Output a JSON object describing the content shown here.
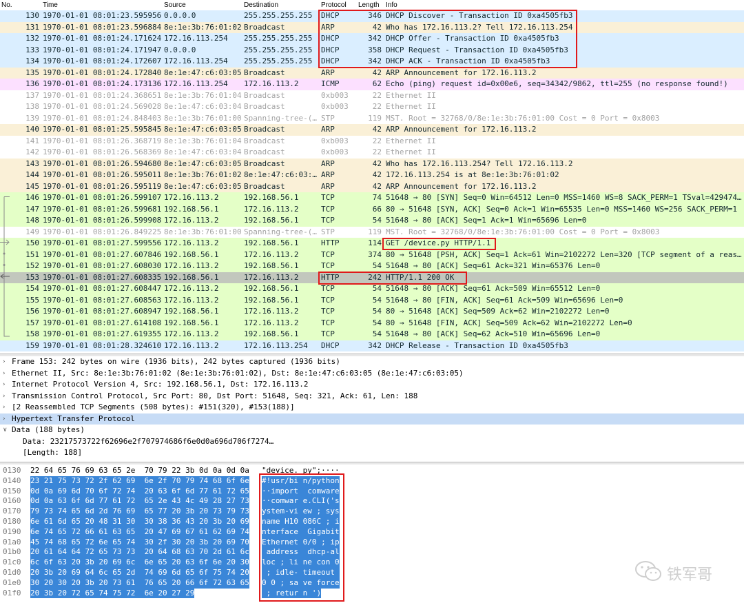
{
  "columns": {
    "no": "No.",
    "time": "Time",
    "source": "Source",
    "destination": "Destination",
    "protocol": "Protocol",
    "length": "Length",
    "info": "Info"
  },
  "packets": [
    {
      "no": "130",
      "time": "1970-01-01 08:01:23.595956",
      "src": "0.0.0.0",
      "dst": "255.255.255.255",
      "proto": "DHCP",
      "len": "346",
      "info": "DHCP Discover - Transaction ID 0xa4505fb3",
      "cls": "dhcp"
    },
    {
      "no": "131",
      "time": "1970-01-01 08:01:23.596884",
      "src": "8e:1e:3b:76:01:02",
      "dst": "Broadcast",
      "proto": "ARP",
      "len": "42",
      "info": "Who has 172.16.113.2? Tell 172.16.113.254",
      "cls": "arp"
    },
    {
      "no": "132",
      "time": "1970-01-01 08:01:24.171624",
      "src": "172.16.113.254",
      "dst": "255.255.255.255",
      "proto": "DHCP",
      "len": "342",
      "info": "DHCP Offer    - Transaction ID 0xa4505fb3",
      "cls": "dhcp"
    },
    {
      "no": "133",
      "time": "1970-01-01 08:01:24.171947",
      "src": "0.0.0.0",
      "dst": "255.255.255.255",
      "proto": "DHCP",
      "len": "358",
      "info": "DHCP Request  - Transaction ID 0xa4505fb3",
      "cls": "dhcp"
    },
    {
      "no": "134",
      "time": "1970-01-01 08:01:24.172607",
      "src": "172.16.113.254",
      "dst": "255.255.255.255",
      "proto": "DHCP",
      "len": "342",
      "info": "DHCP ACK      - Transaction ID 0xa4505fb3",
      "cls": "dhcp"
    },
    {
      "no": "135",
      "time": "1970-01-01 08:01:24.172840",
      "src": "8e:1e:47:c6:03:05",
      "dst": "Broadcast",
      "proto": "ARP",
      "len": "42",
      "info": "ARP Announcement for 172.16.113.2",
      "cls": "arp"
    },
    {
      "no": "136",
      "time": "1970-01-01 08:01:24.173136",
      "src": "172.16.113.254",
      "dst": "172.16.113.2",
      "proto": "ICMP",
      "len": "62",
      "info": "Echo (ping) request  id=0x00e6, seq=34342/9862, ttl=255 (no response found!)",
      "cls": "icmp"
    },
    {
      "no": "137",
      "time": "1970-01-01 08:01:24.368651",
      "src": "8e:1e:3b:76:01:04",
      "dst": "Broadcast",
      "proto": "0xb003",
      "len": "22",
      "info": "Ethernet II",
      "cls": "stp"
    },
    {
      "no": "138",
      "time": "1970-01-01 08:01:24.569028",
      "src": "8e:1e:47:c6:03:04",
      "dst": "Broadcast",
      "proto": "0xb003",
      "len": "22",
      "info": "Ethernet II",
      "cls": "stp"
    },
    {
      "no": "139",
      "time": "1970-01-01 08:01:24.848403",
      "src": "8e:1e:3b:76:01:00",
      "dst": "Spanning-tree-(…",
      "proto": "STP",
      "len": "119",
      "info": "MST. Root = 32768/0/8e:1e:3b:76:01:00  Cost = 0  Port = 0x8003",
      "cls": "stp"
    },
    {
      "no": "140",
      "time": "1970-01-01 08:01:25.595845",
      "src": "8e:1e:47:c6:03:05",
      "dst": "Broadcast",
      "proto": "ARP",
      "len": "42",
      "info": "ARP Announcement for 172.16.113.2",
      "cls": "arp"
    },
    {
      "no": "141",
      "time": "1970-01-01 08:01:26.368719",
      "src": "8e:1e:3b:76:01:04",
      "dst": "Broadcast",
      "proto": "0xb003",
      "len": "22",
      "info": "Ethernet II",
      "cls": "stp"
    },
    {
      "no": "142",
      "time": "1970-01-01 08:01:26.568369",
      "src": "8e:1e:47:c6:03:04",
      "dst": "Broadcast",
      "proto": "0xb003",
      "len": "22",
      "info": "Ethernet II",
      "cls": "stp"
    },
    {
      "no": "143",
      "time": "1970-01-01 08:01:26.594680",
      "src": "8e:1e:47:c6:03:05",
      "dst": "Broadcast",
      "proto": "ARP",
      "len": "42",
      "info": "Who has 172.16.113.254? Tell 172.16.113.2",
      "cls": "arp"
    },
    {
      "no": "144",
      "time": "1970-01-01 08:01:26.595011",
      "src": "8e:1e:3b:76:01:02",
      "dst": "8e:1e:47:c6:03:…",
      "proto": "ARP",
      "len": "42",
      "info": "172.16.113.254 is at 8e:1e:3b:76:01:02",
      "cls": "arp"
    },
    {
      "no": "145",
      "time": "1970-01-01 08:01:26.595119",
      "src": "8e:1e:47:c6:03:05",
      "dst": "Broadcast",
      "proto": "ARP",
      "len": "42",
      "info": "ARP Announcement for 172.16.113.2",
      "cls": "arp"
    },
    {
      "no": "146",
      "time": "1970-01-01 08:01:26.599107",
      "src": "172.16.113.2",
      "dst": "192.168.56.1",
      "proto": "TCP",
      "len": "74",
      "info": "51648 → 80 [SYN] Seq=0 Win=64512 Len=0 MSS=1460 WS=8 SACK_PERM=1 TSval=429474…",
      "cls": "tcp"
    },
    {
      "no": "147",
      "time": "1970-01-01 08:01:26.599681",
      "src": "192.168.56.1",
      "dst": "172.16.113.2",
      "proto": "TCP",
      "len": "66",
      "info": "80 → 51648 [SYN, ACK] Seq=0 Ack=1 Win=65535 Len=0 MSS=1460 WS=256 SACK_PERM=1",
      "cls": "tcp"
    },
    {
      "no": "148",
      "time": "1970-01-01 08:01:26.599908",
      "src": "172.16.113.2",
      "dst": "192.168.56.1",
      "proto": "TCP",
      "len": "54",
      "info": "51648 → 80 [ACK] Seq=1 Ack=1 Win=65696 Len=0",
      "cls": "tcp"
    },
    {
      "no": "149",
      "time": "1970-01-01 08:01:26.849225",
      "src": "8e:1e:3b:76:01:00",
      "dst": "Spanning-tree-(…",
      "proto": "STP",
      "len": "119",
      "info": "MST. Root = 32768/0/8e:1e:3b:76:01:00  Cost = 0  Port = 0x8003",
      "cls": "stp"
    },
    {
      "no": "150",
      "time": "1970-01-01 08:01:27.599556",
      "src": "172.16.113.2",
      "dst": "192.168.56.1",
      "proto": "HTTP",
      "len": "114",
      "info": "GET /device.py HTTP/1.1",
      "cls": "http"
    },
    {
      "no": "151",
      "time": "1970-01-01 08:01:27.607846",
      "src": "192.168.56.1",
      "dst": "172.16.113.2",
      "proto": "TCP",
      "len": "374",
      "info": "80 → 51648 [PSH, ACK] Seq=1 Ack=61 Win=2102272 Len=320 [TCP segment of a reas…",
      "cls": "tcp"
    },
    {
      "no": "152",
      "time": "1970-01-01 08:01:27.608030",
      "src": "172.16.113.2",
      "dst": "192.168.56.1",
      "proto": "TCP",
      "len": "54",
      "info": "51648 → 80 [ACK] Seq=61 Ack=321 Win=65376 Len=0",
      "cls": "tcp"
    },
    {
      "no": "153",
      "time": "1970-01-01 08:01:27.608335",
      "src": "192.168.56.1",
      "dst": "172.16.113.2",
      "proto": "HTTP",
      "len": "242",
      "info": "HTTP/1.1 200 OK",
      "cls": "sel"
    },
    {
      "no": "154",
      "time": "1970-01-01 08:01:27.608447",
      "src": "172.16.113.2",
      "dst": "192.168.56.1",
      "proto": "TCP",
      "len": "54",
      "info": "51648 → 80 [ACK] Seq=61 Ack=509 Win=65512 Len=0",
      "cls": "tcp"
    },
    {
      "no": "155",
      "time": "1970-01-01 08:01:27.608563",
      "src": "172.16.113.2",
      "dst": "192.168.56.1",
      "proto": "TCP",
      "len": "54",
      "info": "51648 → 80 [FIN, ACK] Seq=61 Ack=509 Win=65696 Len=0",
      "cls": "tcp"
    },
    {
      "no": "156",
      "time": "1970-01-01 08:01:27.608947",
      "src": "192.168.56.1",
      "dst": "172.16.113.2",
      "proto": "TCP",
      "len": "54",
      "info": "80 → 51648 [ACK] Seq=509 Ack=62 Win=2102272 Len=0",
      "cls": "tcp"
    },
    {
      "no": "157",
      "time": "1970-01-01 08:01:27.614108",
      "src": "192.168.56.1",
      "dst": "172.16.113.2",
      "proto": "TCP",
      "len": "54",
      "info": "80 → 51648 [FIN, ACK] Seq=509 Ack=62 Win=2102272 Len=0",
      "cls": "tcp"
    },
    {
      "no": "158",
      "time": "1970-01-01 08:01:27.619355",
      "src": "172.16.113.2",
      "dst": "192.168.56.1",
      "proto": "TCP",
      "len": "54",
      "info": "51648 → 80 [ACK] Seq=62 Ack=510 Win=65696 Len=0",
      "cls": "tcp"
    },
    {
      "no": "159",
      "time": "1970-01-01 08:01:28.324610",
      "src": "172.16.113.2",
      "dst": "172.16.113.254",
      "proto": "DHCP",
      "len": "342",
      "info": "DHCP Release  - Transaction ID 0xa4505fb3",
      "cls": "dhcp"
    }
  ],
  "details": [
    {
      "arrow": ">",
      "text": "Frame 153: 242 bytes on wire (1936 bits), 242 bytes captured (1936 bits)",
      "sub": false,
      "selected": false
    },
    {
      "arrow": ">",
      "text": "Ethernet II, Src: 8e:1e:3b:76:01:02 (8e:1e:3b:76:01:02), Dst: 8e:1e:47:c6:03:05 (8e:1e:47:c6:03:05)",
      "sub": false,
      "selected": false
    },
    {
      "arrow": ">",
      "text": "Internet Protocol Version 4, Src: 192.168.56.1, Dst: 172.16.113.2",
      "sub": false,
      "selected": false
    },
    {
      "arrow": ">",
      "text": "Transmission Control Protocol, Src Port: 80, Dst Port: 51648, Seq: 321, Ack: 61, Len: 188",
      "sub": false,
      "selected": false
    },
    {
      "arrow": ">",
      "text": "[2 Reassembled TCP Segments (508 bytes): #151(320), #153(188)]",
      "sub": false,
      "selected": false
    },
    {
      "arrow": ">",
      "text": "Hypertext Transfer Protocol",
      "sub": false,
      "selected": true
    },
    {
      "arrow": "v",
      "text": "Data (188 bytes)",
      "sub": false,
      "selected": false
    },
    {
      "arrow": "",
      "text": "Data: 23217573722f62696e2f707974686f6e0d0a696d706f7274…",
      "sub": true,
      "selected": false
    },
    {
      "arrow": "",
      "text": "[Length: 188]",
      "sub": true,
      "selected": false
    }
  ],
  "bytes": [
    {
      "off": "0130",
      "hex": "22 64 65 76 69 63 65 2e  70 79 22 3b 0d 0a 0d 0a",
      "asc": "\"device. py\";····",
      "sel": false
    },
    {
      "off": "0140",
      "hex": "23 21 75 73 72 2f 62 69  6e 2f 70 79 74 68 6f 6e",
      "asc": "#!usr/bi n/python",
      "sel": true
    },
    {
      "off": "0150",
      "hex": "0d 0a 69 6d 70 6f 72 74  20 63 6f 6d 77 61 72 65",
      "asc": "··import  comware",
      "sel": true
    },
    {
      "off": "0160",
      "hex": "0d 0a 63 6f 6d 77 61 72  65 2e 43 4c 49 28 27 73",
      "asc": "··comwar e.CLI('s",
      "sel": true
    },
    {
      "off": "0170",
      "hex": "79 73 74 65 6d 2d 76 69  65 77 20 3b 20 73 79 73",
      "asc": "ystem-vi ew ; sys",
      "sel": true
    },
    {
      "off": "0180",
      "hex": "6e 61 6d 65 20 48 31 30  30 38 36 43 20 3b 20 69",
      "asc": "name H10 086C ; i",
      "sel": true
    },
    {
      "off": "0190",
      "hex": "6e 74 65 72 66 61 63 65  20 47 69 67 61 62 69 74",
      "asc": "nterface  Gigabit",
      "sel": true
    },
    {
      "off": "01a0",
      "hex": "45 74 68 65 72 6e 65 74  30 2f 30 20 3b 20 69 70",
      "asc": "Ethernet 0/0 ; ip",
      "sel": true
    },
    {
      "off": "01b0",
      "hex": "20 61 64 64 72 65 73 73  20 64 68 63 70 2d 61 6c",
      "asc": " address  dhcp-al",
      "sel": true
    },
    {
      "off": "01c0",
      "hex": "6c 6f 63 20 3b 20 69 6c  6e 65 20 63 6f 6e 20 30",
      "asc": "loc ; li ne con 0",
      "sel": true
    },
    {
      "off": "01d0",
      "hex": "20 3b 20 69 64 6c 65 2d  74 69 6d 65 6f 75 74 20",
      "asc": " ; idle- timeout ",
      "sel": true
    },
    {
      "off": "01e0",
      "hex": "30 20 30 20 3b 20 73 61  76 65 20 66 6f 72 63 65",
      "asc": "0 0 ; sa ve force",
      "sel": true
    },
    {
      "off": "01f0",
      "hex": "20 3b 20 72 65 74 75 72  6e 20 27 29",
      "asc": " ; retur n ')",
      "sel": true
    }
  ],
  "watermark": {
    "text": "铁军哥",
    "icon": "wechat-icon"
  },
  "colors": {
    "dhcp": "#daeeff",
    "arp": "#faf0d7",
    "icmp": "#fce0ff",
    "tcp": "#e4ffc7",
    "selected_row": "#c2c7bd",
    "highlight_box": "#e0191b",
    "selected_bytes": "#3a86d8",
    "selected_detail": "#c7dcf6"
  }
}
